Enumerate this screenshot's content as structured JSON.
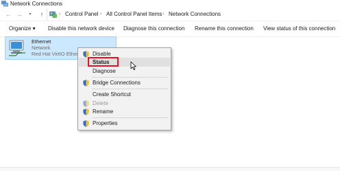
{
  "window": {
    "title": "Network Connections"
  },
  "address": {
    "crumbs": [
      "Control Panel",
      "All Control Panel Items",
      "Network Connections"
    ]
  },
  "toolbar": {
    "organize": "Organize ▾",
    "disable": "Disable this network device",
    "diagnose": "Diagnose this connection",
    "rename": "Rename this connection",
    "view_status": "View status of this connection"
  },
  "connection": {
    "name": "Ethernet",
    "status": "Network",
    "device": "Red Hat VirtIO Ethernet Adapter"
  },
  "context_menu": {
    "items": [
      {
        "label": "Disable",
        "shield": true
      },
      {
        "label": "Status",
        "shield": false
      },
      {
        "label": "Diagnose",
        "shield": false
      },
      {
        "label": "Bridge Connections",
        "shield": true
      },
      {
        "label": "Create Shortcut",
        "shield": false
      },
      {
        "label": "Delete",
        "shield": true,
        "disabled": true
      },
      {
        "label": "Rename",
        "shield": true
      },
      {
        "label": "Properties",
        "shield": true
      }
    ]
  },
  "colors": {
    "selection_bg": "#cce8ff",
    "selection_border": "#99d1ff",
    "highlight_box": "#e81123",
    "menu_bg": "#f2f2f2"
  }
}
